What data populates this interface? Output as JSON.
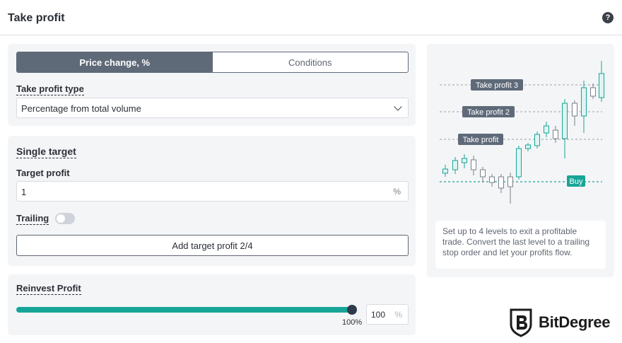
{
  "header": {
    "title": "Take profit"
  },
  "tabs": [
    {
      "label": "Price change, %",
      "active": true
    },
    {
      "label": "Conditions",
      "active": false
    }
  ],
  "take_profit_type": {
    "label": "Take profit type",
    "value": "Percentage from total volume"
  },
  "single_target": {
    "heading": "Single target",
    "target_profit_label": "Target profit",
    "target_profit_value": "1",
    "target_profit_unit": "%",
    "trailing_label": "Trailing",
    "trailing_enabled": false,
    "add_button": "Add target profit 2/4"
  },
  "reinvest": {
    "label": "Reinvest Profit",
    "slider_fraction": 1.0,
    "slider_value_label": "100%",
    "input_value": "100",
    "input_unit": "%"
  },
  "illustration": {
    "labels": {
      "tp3": "Take profit 3",
      "tp2": "Take profit 2",
      "tp1": "Take profit",
      "buy": "Buy"
    },
    "description": "Set up to 4 levels to exit a profitable trade. Convert the last level to a trailing stop order and let your profits flow."
  },
  "brand": {
    "name": "BitDegree"
  },
  "colors": {
    "accent": "#17a597",
    "tab_active": "#5f6a79",
    "label_bg": "#5f6a79"
  }
}
